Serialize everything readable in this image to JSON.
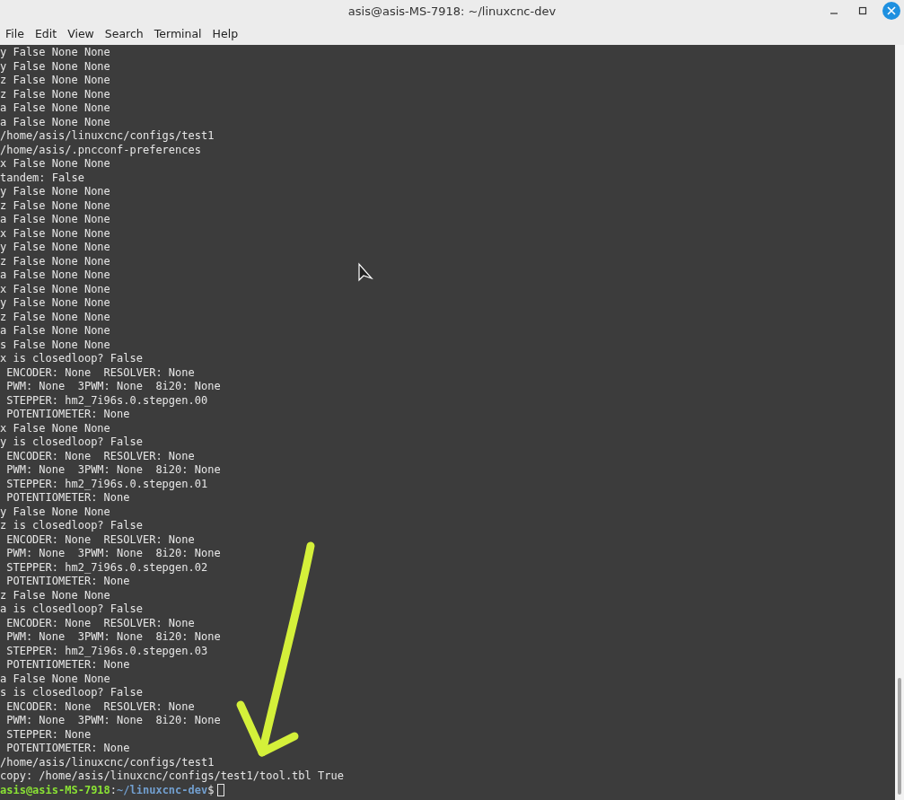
{
  "window": {
    "title": "asis@asis-MS-7918: ~/linuxcnc-dev"
  },
  "menu": [
    "File",
    "Edit",
    "View",
    "Search",
    "Terminal",
    "Help"
  ],
  "terminal": {
    "lines": [
      "y False None None",
      "y False None None",
      "z False None None",
      "z False None None",
      "a False None None",
      "a False None None",
      "/home/asis/linuxcnc/configs/test1",
      "/home/asis/.pncconf-preferences",
      "x False None None",
      "tandem: False",
      "y False None None",
      "z False None None",
      "a False None None",
      "x False None None",
      "y False None None",
      "z False None None",
      "a False None None",
      "x False None None",
      "y False None None",
      "z False None None",
      "a False None None",
      "s False None None",
      "x is closedloop? False",
      " ENCODER: None  RESOLVER: None",
      " PWM: None  3PWM: None  8i20: None",
      " STEPPER: hm2_7i96s.0.stepgen.00",
      " POTENTIOMETER: None",
      "x False None None",
      "y is closedloop? False",
      " ENCODER: None  RESOLVER: None",
      " PWM: None  3PWM: None  8i20: None",
      " STEPPER: hm2_7i96s.0.stepgen.01",
      " POTENTIOMETER: None",
      "y False None None",
      "z is closedloop? False",
      " ENCODER: None  RESOLVER: None",
      " PWM: None  3PWM: None  8i20: None",
      " STEPPER: hm2_7i96s.0.stepgen.02",
      " POTENTIOMETER: None",
      "z False None None",
      "a is closedloop? False",
      " ENCODER: None  RESOLVER: None",
      " PWM: None  3PWM: None  8i20: None",
      " STEPPER: hm2_7i96s.0.stepgen.03",
      " POTENTIOMETER: None",
      "a False None None",
      "s is closedloop? False",
      " ENCODER: None  RESOLVER: None",
      " PWM: None  3PWM: None  8i20: None",
      " STEPPER: None",
      " POTENTIOMETER: None",
      "/home/asis/linuxcnc/configs/test1",
      "copy: /home/asis/linuxcnc/configs/test1/tool.tbl True"
    ],
    "prompt": {
      "user_host": "asis@asis-MS-7918",
      "separator": ":",
      "path": "~/linuxcnc-dev",
      "symbol": "$"
    }
  }
}
